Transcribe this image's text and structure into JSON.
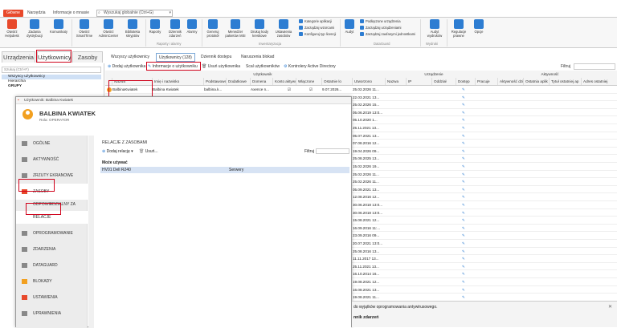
{
  "top_tabs": [
    "Główne",
    "Narzędzia",
    "Informacje o mnasie"
  ],
  "search": {
    "placeholder": "Wyszukaj globalnie (Ctrl+G)"
  },
  "ribbon": {
    "buttons": [
      {
        "label": "Otwórz Helpdesk",
        "color": "#e8492b"
      },
      {
        "label": "Zadania dystrybucji",
        "color": "#2d7dd2"
      },
      {
        "label": "Komunikaty",
        "color": "#2d7dd2"
      },
      {
        "label": "Otwórz SmartTime",
        "color": "#2d7dd2"
      },
      {
        "label": "Otwórz AdminCenter",
        "color": "#2d7dd2"
      },
      {
        "label": "Biblioteka skryptów",
        "color": "#2d7dd2"
      },
      {
        "label": "Raporty",
        "color": "#2d7dd2"
      },
      {
        "label": "Dziennik zdarzeń",
        "color": "#2d7dd2"
      },
      {
        "label": "Alarmy",
        "color": "#2d7dd2"
      },
      {
        "label": "Generuj protokół",
        "color": "#2d7dd2"
      },
      {
        "label": "Menedżer pakietów MSI",
        "color": "#2d7dd2"
      },
      {
        "label": "Drukuj kody kreskowe",
        "color": "#2d7dd2"
      },
      {
        "label": "Ustawienia zasobów",
        "color": "#2d7dd2"
      },
      {
        "label": "Audyt",
        "color": "#2d7dd2"
      },
      {
        "label": "Audyt wydruków",
        "color": "#2d7dd2"
      },
      {
        "label": "Regulacje prawne",
        "color": "#2d7dd2"
      },
      {
        "label": "Opcje",
        "color": "#2d7dd2"
      }
    ],
    "small": [
      "Kategorie aplikacji",
      "Zarządzaj wzorcami",
      "Konfiguruj typ licencji",
      "Podłączone urządzenia",
      "Zarządzaj urządzeniami",
      "Zarządzaj zaufanymi jednostkami"
    ],
    "groups": [
      "Raporty i alarmy",
      "Inwentaryzacja",
      "DataGuard",
      "Wydruki"
    ]
  },
  "main_tabs": [
    "Urządzenia",
    "Użytkownicy",
    "Zasoby"
  ],
  "left": {
    "search_placeholder": "Szukaj (Ctrl+F)",
    "tree": [
      "Wszyscy użytkownicy",
      "Hierarchia",
      "GRUPY"
    ]
  },
  "sub_tabs": [
    "Wszyscy użytkownicy",
    "Użytkownicy (128)",
    "Dziennik dostępu",
    "Naruszenia blokad"
  ],
  "toolbar": [
    "Dodaj użytkownika",
    "Informacje o użytkowniku",
    "Usuń użytkownika",
    "Scal użytkowników",
    "Kontrolery Active Directory"
  ],
  "filter_label": "Filtruj",
  "grid": {
    "group_user": "Użytkownik",
    "group_device": "Urządzenie",
    "group_activity": "Aktywność",
    "columns": [
      "Nazwa",
      "Imię i nazwisko",
      "Podstawowe",
      "Dodatkowe",
      "Domena",
      "Konto aktywowane",
      "Włączone",
      "Ostatnie lo",
      "Utworzono",
      "Nazwa",
      "IP",
      "Oddział",
      "Dostęp",
      "Pracuje",
      "Aktywność dzi",
      "Ostatnia aplik",
      "Tytuł ostatniej ap",
      "Adres ostatniej"
    ],
    "first_row": {
      "name": "BalbinaKwiatek",
      "full": "Balbina Kwiatek",
      "primary": "balbina.k...",
      "domain": "Axence n...",
      "last": "9.07.2026..."
    },
    "created": [
      "25.02.2026 11...",
      "22.03.2021 13...",
      "25.02.2026 15...",
      "05.06.2019 13:0...",
      "05.10.2020 1...",
      "25.11.2021 13...",
      "05.07.2021 13...",
      "07.08.2016 12...",
      "19.04.2026 09...",
      "25.08.2025 13...",
      "15.02.2026 19...",
      "25.02.2026 11...",
      "25.02.2026 11...",
      "05.09.2021 13...",
      "12.08.2016 12...",
      "30.06.2018 13:0...",
      "30.06.2018 13:0...",
      "15.08.2021 12...",
      "16.09.2016 11:...",
      "23.09.2016 09...",
      "20.07.2021 13:0...",
      "25.08.2016 13...",
      "11.11.2017 13...",
      "25.11.2021 13...",
      "16.10.2014 16...",
      "19.08.2021 12...",
      "16.08.2021 13...",
      "19.08.2021 11...",
      "19.10.2025 13...",
      "29.09.2021 07...",
      "06.03.2017 10..."
    ]
  },
  "dialog": {
    "title": "Użytkownik: Balbina Kwiatek",
    "name": "BALBINA KWIATEK",
    "role_label": "Rola:",
    "role": "OPERATOR",
    "nav": [
      "OGÓLNE",
      "AKTYWNOŚĆ",
      "ZRZUTY EKRANOWE",
      "ZASOBY",
      "ODPOWIEDZIALNY ZA",
      "RELACJE",
      "OPROGRAMOWANIE",
      "ZDARZENIA",
      "DATAGUARD",
      "BLOKADY",
      "USTAWIENIA",
      "UPRAWNIENIA"
    ],
    "section_title": "RELACJE Z ZASOBAMI",
    "add_label": "Dodaj relację",
    "delete_label": "Usuń...",
    "filter_label": "Filtruj",
    "relation_header": "Może używać",
    "relation": {
      "asset": "HV01 Dell R240",
      "category": "Serwery"
    }
  },
  "bottom": {
    "line1": "do wyjątków oprogramowania antywirusowego.",
    "line2": "nnik zdarzeń"
  }
}
